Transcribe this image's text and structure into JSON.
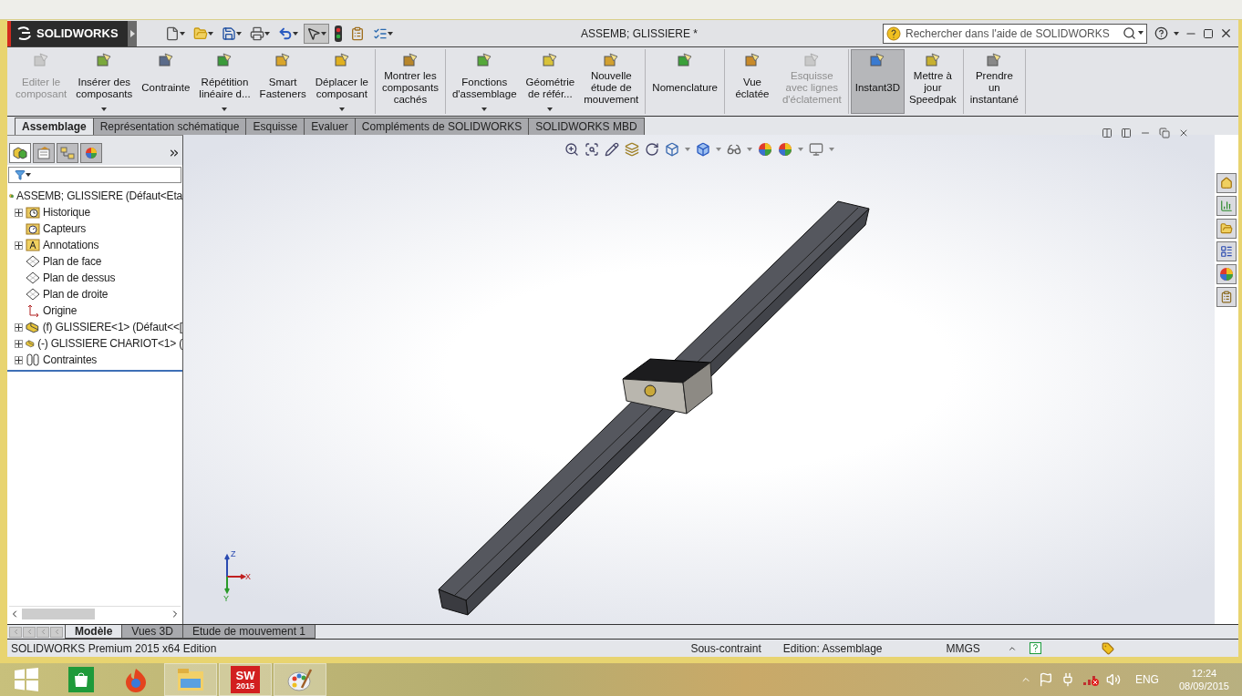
{
  "app": {
    "brand": "SOLIDWORKS"
  },
  "window": {
    "title": "ASSEMB; GLISSIERE *"
  },
  "search": {
    "placeholder": "Rechercher dans l'aide de SOLIDWORKS"
  },
  "command_groups": [
    [
      {
        "lines": [
          "Editer le",
          "composant"
        ],
        "disabled": true,
        "menu": false,
        "selected": false
      },
      {
        "lines": [
          "Insérer des",
          "composants"
        ],
        "disabled": false,
        "menu": true,
        "selected": false
      },
      {
        "lines": [
          "Contrainte"
        ],
        "disabled": false,
        "menu": false,
        "selected": false
      },
      {
        "lines": [
          "Répétition",
          "linéaire d..."
        ],
        "disabled": false,
        "menu": true,
        "selected": false
      },
      {
        "lines": [
          "Smart",
          "Fasteners"
        ],
        "disabled": false,
        "menu": false,
        "selected": false
      },
      {
        "lines": [
          "Déplacer le",
          "composant"
        ],
        "disabled": false,
        "menu": true,
        "selected": false
      }
    ],
    [
      {
        "lines": [
          "Montrer les",
          "composants",
          "cachés"
        ],
        "disabled": false,
        "menu": false,
        "selected": false
      }
    ],
    [
      {
        "lines": [
          "Fonctions",
          "d'assemblage"
        ],
        "disabled": false,
        "menu": true,
        "selected": false
      },
      {
        "lines": [
          "Géométrie",
          "de référ..."
        ],
        "disabled": false,
        "menu": true,
        "selected": false
      },
      {
        "lines": [
          "Nouvelle",
          "étude de",
          "mouvement"
        ],
        "disabled": false,
        "menu": false,
        "selected": false
      }
    ],
    [
      {
        "lines": [
          "Nomenclature"
        ],
        "disabled": false,
        "menu": false,
        "selected": false
      }
    ],
    [
      {
        "lines": [
          "Vue",
          "éclatée"
        ],
        "disabled": false,
        "menu": false,
        "selected": false
      },
      {
        "lines": [
          "Esquisse",
          "avec lignes",
          "d'éclatement"
        ],
        "disabled": true,
        "menu": false,
        "selected": false
      }
    ],
    [
      {
        "lines": [
          "Instant3D"
        ],
        "disabled": false,
        "menu": false,
        "selected": true
      },
      {
        "lines": [
          "Mettre à",
          "jour",
          "Speedpak"
        ],
        "disabled": false,
        "menu": false,
        "selected": false
      }
    ],
    [
      {
        "lines": [
          "Prendre",
          "un",
          "instantané"
        ],
        "disabled": false,
        "menu": false,
        "selected": false
      }
    ]
  ],
  "tabs": [
    {
      "label": "Assemblage",
      "selected": true
    },
    {
      "label": "Représentation schématique",
      "selected": false
    },
    {
      "label": "Esquisse",
      "selected": false
    },
    {
      "label": "Evaluer",
      "selected": false
    },
    {
      "label": "Compléments de SOLIDWORKS",
      "selected": false
    },
    {
      "label": "SOLIDWORKS MBD",
      "selected": false
    }
  ],
  "panel_tabs": [
    {
      "selected": true
    },
    {
      "selected": false
    },
    {
      "selected": false
    },
    {
      "selected": false
    }
  ],
  "tree": {
    "label": "ASSEMB; GLISSIERE (Défaut<Eta",
    "kind": "assembly",
    "children": [
      {
        "label": "Historique",
        "kind": "history",
        "expandable": true
      },
      {
        "label": "Capteurs",
        "kind": "sensors",
        "expandable": false
      },
      {
        "label": "Annotations",
        "kind": "annotations",
        "expandable": true
      },
      {
        "label": "Plan de face",
        "kind": "plane",
        "expandable": false
      },
      {
        "label": "Plan de dessus",
        "kind": "plane",
        "expandable": false
      },
      {
        "label": "Plan de droite",
        "kind": "plane",
        "expandable": false
      },
      {
        "label": "Origine",
        "kind": "origin",
        "expandable": false
      },
      {
        "label": "(f) GLISSIERE<1> (Défaut<<[",
        "kind": "part",
        "expandable": true
      },
      {
        "label": "(-) GLISSIERE CHARIOT<1> (",
        "kind": "part",
        "expandable": true
      },
      {
        "label": "Contraintes",
        "kind": "mates",
        "expandable": true
      }
    ]
  },
  "triad": {
    "z": "Z",
    "x": "X",
    "y": "Y"
  },
  "bottom_tabs": [
    {
      "label": "Modèle",
      "selected": true
    },
    {
      "label": "Vues 3D",
      "selected": false
    },
    {
      "label": "Etude de mouvement 1",
      "selected": false
    }
  ],
  "status_bar": {
    "product": "SOLIDWORKS Premium 2015 x64 Edition",
    "items": [
      "Sous-contraint",
      "Edition: Assemblage",
      "MMGS"
    ]
  },
  "taskbar": {
    "apps": [
      {
        "kind": "store",
        "active": false
      },
      {
        "kind": "browser",
        "active": false
      },
      {
        "kind": "explorer",
        "active": true
      },
      {
        "kind": "solidworks",
        "active": true,
        "mark": "SW",
        "badge": "2015"
      },
      {
        "kind": "paint",
        "active": true
      }
    ],
    "language": "ENG",
    "time": "12:24",
    "date": "08/09/2015"
  }
}
